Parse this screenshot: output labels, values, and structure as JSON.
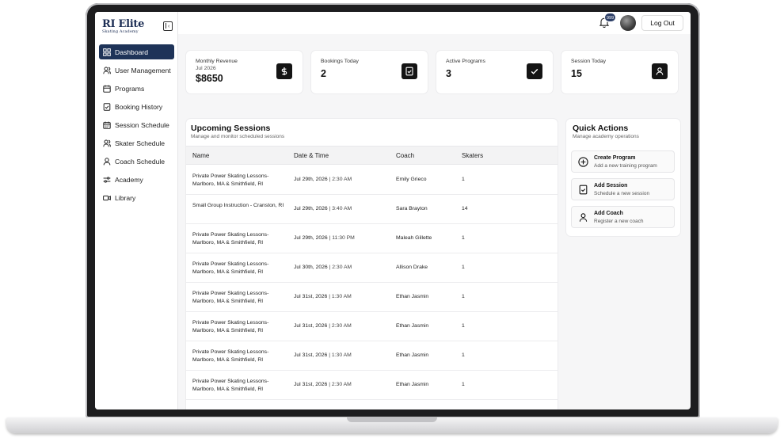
{
  "brand": {
    "logo_main": "RI Elite",
    "logo_sub": "Skating Academy"
  },
  "sidebar": {
    "items": [
      {
        "label": "Dashboard",
        "icon": "dashboard-icon",
        "active": true
      },
      {
        "label": "User Management",
        "icon": "users-icon"
      },
      {
        "label": "Programs",
        "icon": "programs-icon"
      },
      {
        "label": "Booking History",
        "icon": "booking-icon"
      },
      {
        "label": "Session Schedule",
        "icon": "calendar-icon"
      },
      {
        "label": "Skater Schedule",
        "icon": "skater-icon"
      },
      {
        "label": "Coach Schedule",
        "icon": "coach-icon"
      },
      {
        "label": "Academy",
        "icon": "academy-icon"
      },
      {
        "label": "Library",
        "icon": "library-icon"
      }
    ]
  },
  "header": {
    "notification_count": "999",
    "logout_label": "Log Out"
  },
  "stats": [
    {
      "label": "Monthly Revenue",
      "sub": "Jul 2026",
      "value": "$8650",
      "icon": "dollar-icon"
    },
    {
      "label": "Bookings Today",
      "sub": "",
      "value": "2",
      "icon": "clipboard-check-icon"
    },
    {
      "label": "Active Programs",
      "sub": "",
      "value": "3",
      "icon": "check-icon"
    },
    {
      "label": "Session Today",
      "sub": "",
      "value": "15",
      "icon": "user-icon"
    }
  ],
  "sessions": {
    "title": "Upcoming Sessions",
    "subtitle": "Manage and monitor scheduled sessions",
    "columns": [
      "Name",
      "Date & Time",
      "Coach",
      "Skaters"
    ],
    "rows": [
      {
        "name": "Private Power Skating Lessons- Marlboro, MA & Smithfield, RI",
        "date": "Jul 29th, 2026",
        "time": "2:30 AM",
        "coach": "Emily Grieco",
        "skaters": "1"
      },
      {
        "name": "Small Group Instruction - Cranston, RI",
        "date": "Jul 29th, 2026",
        "time": "3:40 AM",
        "coach": "Sara Brayton",
        "skaters": "14"
      },
      {
        "name": "Private Power Skating Lessons- Marlboro, MA & Smithfield, RI",
        "date": "Jul 29th, 2026",
        "time": "11:30 PM",
        "coach": "Maleah Gillette",
        "skaters": "1"
      },
      {
        "name": "Private Power Skating Lessons- Marlboro, MA & Smithfield, RI",
        "date": "Jul 30th, 2026",
        "time": "2:30 AM",
        "coach": "Allison Drake",
        "skaters": "1"
      },
      {
        "name": "Private Power Skating Lessons- Marlboro, MA & Smithfield, RI",
        "date": "Jul 31st, 2026",
        "time": "1:30 AM",
        "coach": "Ethan Jasmin",
        "skaters": "1"
      },
      {
        "name": "Private Power Skating Lessons- Marlboro, MA & Smithfield, RI",
        "date": "Jul 31st, 2026",
        "time": "2:30 AM",
        "coach": "Ethan Jasmin",
        "skaters": "1"
      },
      {
        "name": "Private Power Skating Lessons- Marlboro, MA & Smithfield, RI",
        "date": "Jul 31st, 2026",
        "time": "1:30 AM",
        "coach": "Ethan Jasmin",
        "skaters": "1"
      },
      {
        "name": "Private Power Skating Lessons- Marlboro, MA & Smithfield, RI",
        "date": "Jul 31st, 2026",
        "time": "2:30 AM",
        "coach": "Ethan Jasmin",
        "skaters": "1"
      }
    ]
  },
  "quick_actions": {
    "title": "Quick Actions",
    "subtitle": "Manage academy operations",
    "items": [
      {
        "label": "Create Program",
        "desc": "Add a new training program",
        "icon": "plus-circle-icon"
      },
      {
        "label": "Add Session",
        "desc": "Schedule a new session",
        "icon": "clipboard-check-icon"
      },
      {
        "label": "Add Coach",
        "desc": "Register a new coach",
        "icon": "user-icon"
      }
    ]
  },
  "colors": {
    "accent": "#1e3358",
    "badge": "#2c3e66",
    "icon_bg": "#141414"
  }
}
